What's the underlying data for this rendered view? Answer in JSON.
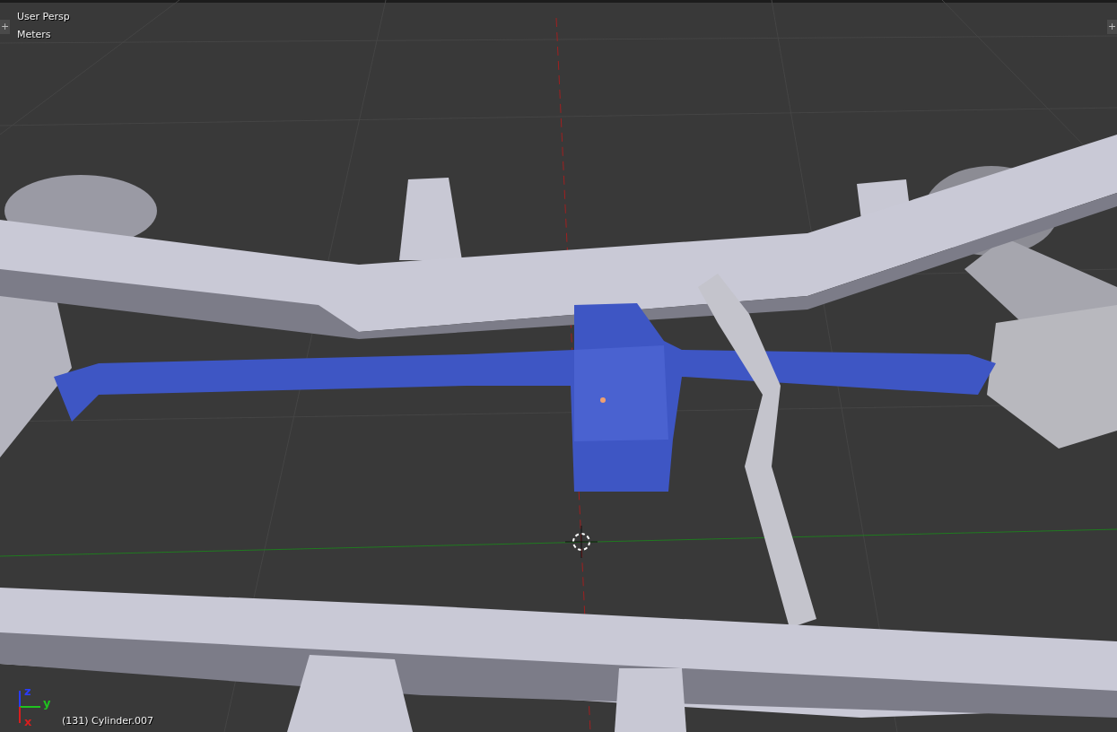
{
  "viewport": {
    "view_name": "User Persp",
    "units": "Meters",
    "object_info": "(131) Cylinder.007",
    "axes": [
      {
        "label": "z",
        "color": "#2a3cff"
      },
      {
        "label": "y",
        "color": "#1fc21f"
      },
      {
        "label": "x",
        "color": "#d81e1e"
      }
    ]
  },
  "region_toggles": [
    "+",
    "+"
  ]
}
